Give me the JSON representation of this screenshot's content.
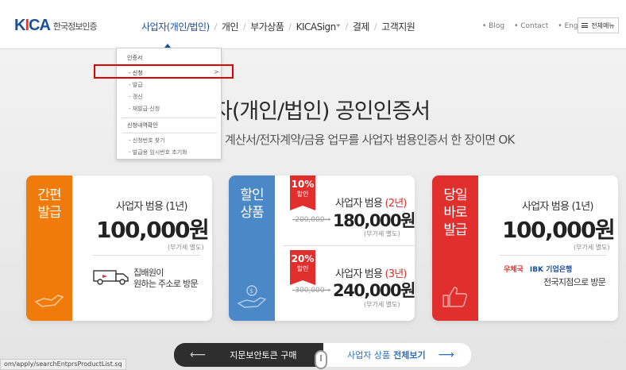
{
  "header": {
    "logo_mark": "KICA",
    "logo_text": "한국정보인증",
    "nav": [
      "사업자(개인/법인)",
      "개인",
      "부가상품",
      "KICASign⁺",
      "결제",
      "고객지원"
    ],
    "util": [
      "Blog",
      "Contact",
      "English"
    ],
    "all_menu": "전체메뉴"
  },
  "dropdown": {
    "group1": "인증서",
    "items1": [
      "- 신청",
      "- 발급",
      "- 갱신",
      "- 재발급·신청"
    ],
    "group2": "신청내역확인",
    "items2": [
      "- 신청번호 찾기",
      "- 발급용 임시번호 초기화"
    ],
    "arrow": ">"
  },
  "hero": {
    "title": "자(개인/법인) 공인인증서",
    "subtitle": "계산서/전자계약/금융 업무를 사업자 범용인증서 한 장이면 OK"
  },
  "cards": [
    {
      "band": [
        "간편",
        "발급"
      ],
      "label": "사업자 범용 (1년)",
      "price": "100,000원",
      "vat": "(부가세 별도)",
      "note": [
        "집배원이",
        "원하는 주소로 방문"
      ]
    },
    {
      "band": [
        "할인",
        "상품"
      ],
      "offers": [
        {
          "pct": "10%",
          "disc": "할인",
          "label": "사업자 범용",
          "period": "(2년)",
          "old": "200,000",
          "price": "180,000원",
          "vat": "(부가세 별도)"
        },
        {
          "pct": "20%",
          "disc": "할인",
          "label": "사업자 범용",
          "period": "(3년)",
          "old": "300,000",
          "price": "240,000원",
          "vat": "(부가세 별도)"
        }
      ]
    },
    {
      "band": [
        "당일",
        "바로",
        "발급"
      ],
      "label": "사업자 범용 (1년)",
      "price": "100,000원",
      "vat": "(부가세 별도)",
      "partners": [
        "우체국",
        "IBK 기업은행"
      ],
      "note": "전국지점으로 방문"
    }
  ],
  "bottom": {
    "left": "지문보안토큰 구매",
    "right_normal": "사업자 상품",
    "right_bold": "전체보기"
  },
  "status_url": "om/apply/searchEntprsProductList.sq",
  "colors": {
    "orange": "#f07b0b",
    "blue": "#4a88c8",
    "red": "#e02f2c",
    "navy": "#1a4f9c"
  }
}
